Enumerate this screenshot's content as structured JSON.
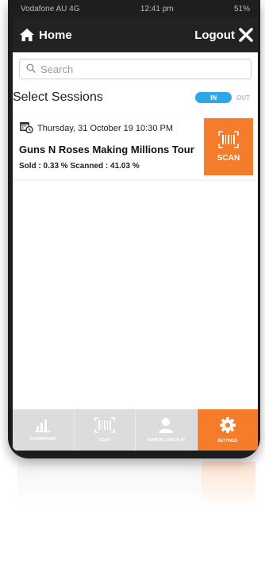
{
  "status_bar": {
    "carrier": "Vodafone AU 4G",
    "time": "12:41 pm",
    "battery": "51%"
  },
  "nav": {
    "home_label": "Home",
    "logout_label": "Logout"
  },
  "search": {
    "placeholder": "Search",
    "value": ""
  },
  "sessions": {
    "title": "Select Sessions",
    "toggle_on_label": "IN",
    "toggle_off_label": "OUT",
    "items": [
      {
        "datetime": "Thursday, 31 October 19 10:30 PM",
        "name": "Guns N Roses Making Millions Tour",
        "stats": "Sold : 0.33 % Scanned : 41.03 %",
        "scan_label": "SCAN"
      }
    ]
  },
  "tabs": [
    {
      "label": "DASHBOARD",
      "icon": "bar-chart-icon",
      "active": false
    },
    {
      "label": "SCAN",
      "icon": "barcode-icon",
      "active": false
    },
    {
      "label": "MANUAL CHECK IN",
      "icon": "user-icon",
      "active": false
    },
    {
      "label": "SETTINGS",
      "icon": "gear-icon",
      "active": true
    }
  ],
  "colors": {
    "accent": "#f47c2b",
    "toggle": "#2ea7e9",
    "nav": "#222222",
    "tab_inactive": "#dcdcdc"
  }
}
